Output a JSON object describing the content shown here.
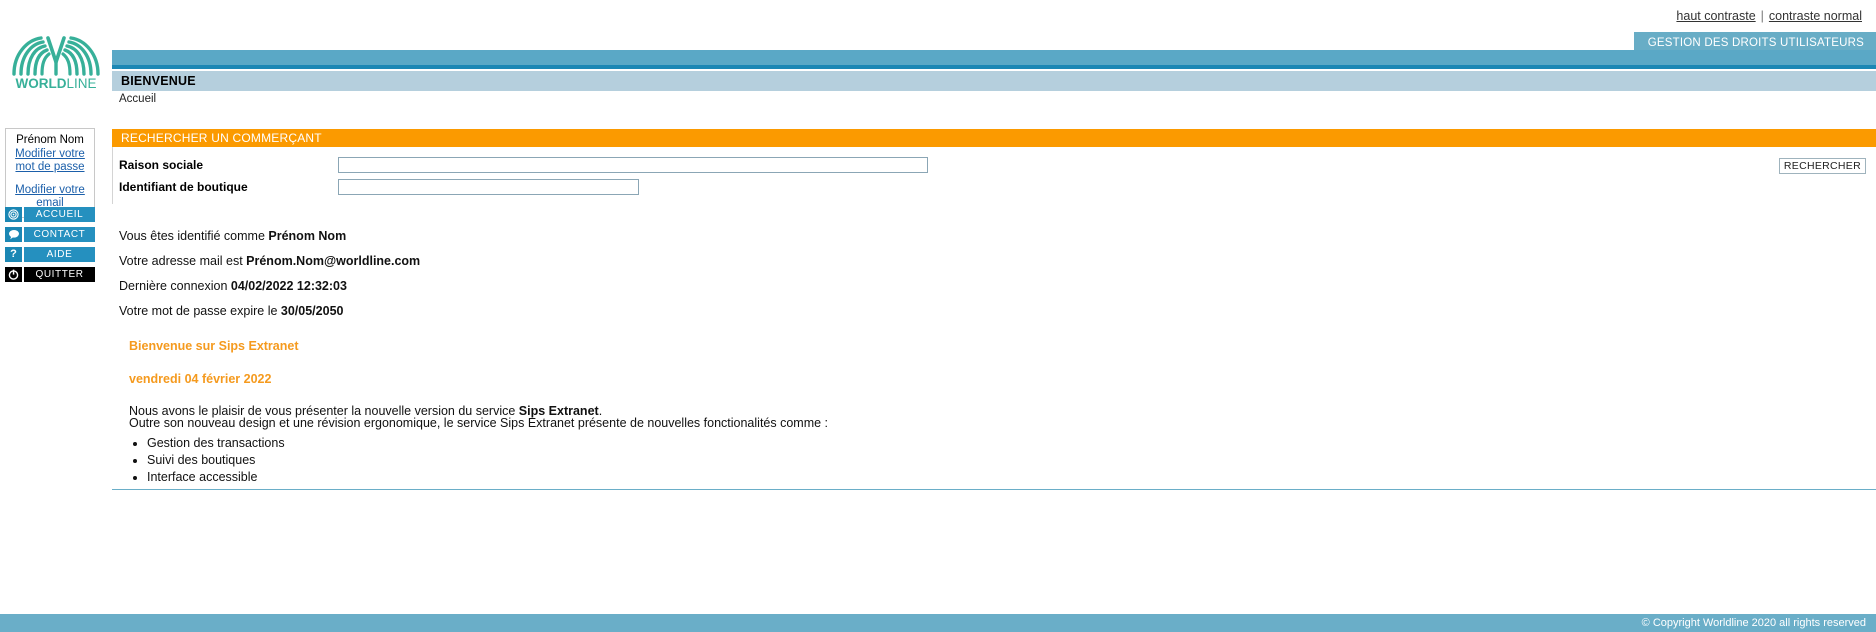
{
  "header": {
    "high_contrast_label": "haut contraste",
    "separator": "|",
    "normal_contrast_label": "contraste normal",
    "user_rights_tab": "GESTION DES DROITS UTILISATEURS",
    "page_title": "BIENVENUE",
    "breadcrumb": "Accueil",
    "logo_text_bold": "WORLD",
    "logo_text_light": "LINE"
  },
  "sidebar": {
    "user_name": "Prénom Nom",
    "change_password_link": "Modifier votre mot de passe",
    "change_email_link": "Modifier votre email",
    "nav_items": [
      {
        "label": "ACCUEIL",
        "icon": "target-icon",
        "glyph": "◎",
        "dark": false
      },
      {
        "label": "CONTACT",
        "icon": "speech-bubble-icon",
        "glyph": "●",
        "dark": false
      },
      {
        "label": "AIDE",
        "icon": "question-mark-icon",
        "glyph": "?",
        "dark": false
      },
      {
        "label": "QUITTER",
        "icon": "power-off-icon",
        "glyph": "Q",
        "dark": true
      }
    ]
  },
  "search_panel": {
    "title": "RECHERCHER UN COMMERÇANT",
    "raison_sociale_label": "Raison sociale",
    "raison_sociale_value": "",
    "raison_sociale_placeholder": "",
    "identifiant_boutique_label": "Identifiant de boutique",
    "identifiant_boutique_value": "",
    "identifiant_boutique_placeholder": "",
    "search_button_label": "RECHERCHER"
  },
  "main": {
    "identified_prefix": "Vous êtes identifié comme ",
    "identified_value": "Prénom Nom",
    "email_prefix": "Votre adresse mail est ",
    "email_value": "Prénom.Nom@worldline.com",
    "last_login_prefix": "Dernière connexion ",
    "last_login_value": "04/02/2022 12:32:03",
    "password_expiry_prefix": "Votre mot de passe expire le ",
    "password_expiry_value": "30/05/2050",
    "welcome_heading": "Bienvenue sur Sips Extranet",
    "date_heading": "vendredi 04 février 2022",
    "para_1_before": "Nous avons le plaisir de vous présenter la nouvelle version du service ",
    "para_1_bold": "Sips Extranet",
    "para_1_after": ".",
    "para_2": "Outre son nouveau design et une révision ergonomique, le service Sips Extranet présente de nouvelles fonctionalités comme :",
    "features": [
      "Gestion des transactions",
      "Suivi des boutiques",
      "Interface accessible"
    ]
  },
  "footer": {
    "copyright": "© Copyright Worldline 2020 all rights reserved"
  },
  "colors": {
    "brand_teal": "#37b099",
    "header_blue": "#5aa8c6",
    "accent_blue": "#1b87b4",
    "title_bar_blue": "#b5cfdd",
    "orange": "#fb9a00",
    "orange_text": "#f59a1e",
    "footer_blue": "#6aaec8",
    "link_blue": "#1b5faa"
  }
}
